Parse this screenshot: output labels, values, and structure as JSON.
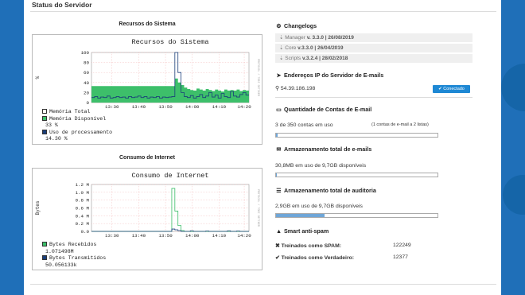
{
  "panel": {
    "title": "Status do Servidor"
  },
  "sys": {
    "section_title": "Recursos do Sistema",
    "chart_title": "Recursos do Sistema",
    "ylabel": "%",
    "side_label": "PROTOCOL / TOBI OETIKER",
    "legend": [
      {
        "label": "Memória Total",
        "value": "",
        "color": "#ffffff"
      },
      {
        "label": "Memória Disponível",
        "value": "33 %",
        "color": "#3dbf6a"
      },
      {
        "label": "Uso de processamento",
        "value": "14.30 %",
        "color": "#1a3f7a"
      }
    ]
  },
  "net": {
    "section_title": "Consumo de Internet",
    "chart_title": "Consumo de Internet",
    "ylabel": "Bytes",
    "side_label": "PROTOCOL / TOBI OETIKER",
    "legend": [
      {
        "label": "Bytes Recebidos",
        "value": "1.071498M",
        "color": "#3dbf6a"
      },
      {
        "label": "Bytes Transmitidos",
        "value": "50.056133k",
        "color": "#1a3f7a"
      }
    ]
  },
  "chart_data": [
    {
      "type": "area",
      "title": "Recursos do Sistema",
      "ylabel": "%",
      "ylim": [
        0,
        100
      ],
      "x_ticks": [
        "13:30",
        "13:40",
        "13:50",
        "14:00",
        "14:10",
        "14:20"
      ],
      "y_ticks": [
        "0",
        "20",
        "40",
        "60",
        "80",
        "100"
      ],
      "series": [
        {
          "name": "Memória Disponível",
          "values": [
            33,
            33,
            33,
            33,
            33,
            33,
            33,
            33,
            33,
            33,
            33,
            33,
            33,
            33,
            33,
            33,
            33,
            33,
            33,
            33,
            33,
            33,
            33,
            33,
            33,
            33,
            33,
            48,
            40,
            35,
            30,
            27,
            25,
            24,
            28,
            26,
            24,
            27,
            25,
            23,
            26,
            24,
            22,
            26,
            24,
            25,
            24,
            26,
            23,
            25,
            24
          ]
        },
        {
          "name": "Uso de processamento",
          "values": [
            10,
            12,
            9,
            11,
            10,
            13,
            9,
            10,
            12,
            10,
            11,
            9,
            12,
            10,
            11,
            13,
            10,
            12,
            9,
            11,
            10,
            12,
            9,
            11,
            10,
            11,
            12,
            100,
            60,
            20,
            12,
            10,
            14,
            9,
            12,
            16,
            10,
            13,
            20,
            11,
            15,
            9,
            18,
            12,
            10,
            22,
            13,
            11,
            16,
            20,
            15
          ]
        }
      ]
    },
    {
      "type": "line",
      "title": "Consumo de Internet",
      "ylabel": "Bytes",
      "ylim": [
        0,
        1200000
      ],
      "x_ticks": [
        "13:30",
        "13:40",
        "13:50",
        "14:00",
        "14:10",
        "14:20"
      ],
      "y_ticks": [
        "0.0",
        "0.2 M",
        "0.4 M",
        "0.6 M",
        "0.8 M",
        "1.0 M",
        "1.2 M"
      ],
      "series": [
        {
          "name": "Bytes Recebidos",
          "values": [
            0,
            0,
            0,
            0,
            0,
            0,
            0,
            0,
            0,
            0,
            0,
            0,
            0,
            0,
            0,
            0,
            0,
            0,
            0,
            0,
            0,
            0,
            0,
            0,
            0,
            0,
            1100000,
            520000,
            150000,
            20000,
            0,
            0,
            0,
            0,
            0,
            0,
            0,
            0,
            0,
            0,
            0,
            0,
            0,
            0,
            0,
            0,
            0,
            0,
            0,
            0,
            0
          ]
        },
        {
          "name": "Bytes Transmitidos",
          "values": [
            0,
            0,
            0,
            0,
            0,
            0,
            0,
            0,
            0,
            0,
            0,
            0,
            0,
            0,
            0,
            0,
            0,
            0,
            0,
            0,
            0,
            0,
            0,
            0,
            0,
            0,
            60000,
            40000,
            20000,
            0,
            0,
            0,
            15000,
            0,
            0,
            0,
            0,
            10000,
            0,
            0,
            0,
            0,
            0,
            0,
            15000,
            0,
            0,
            10000,
            0,
            0,
            0
          ]
        }
      ]
    }
  ],
  "changelogs": {
    "title": "Changelogs",
    "items": [
      {
        "name": "Manager",
        "version": "v. 3.3.0 | 26/08/2019"
      },
      {
        "name": "Core",
        "version": "v.3.3.0 | 26/04/2019"
      },
      {
        "name": "Scripts",
        "version": "v.3.2.4 | 28/02/2018"
      }
    ]
  },
  "ip": {
    "title": "Endereços IP do Servidor de E-mails",
    "address": "54.39.186.198",
    "status": "Conectado"
  },
  "accounts": {
    "title": "Quantidade de Contas de E-mail",
    "text": "3 de 350 contas em uso",
    "note": "(1 contas de e-mail a 2 listas)",
    "fraction": 0.0086
  },
  "storage": {
    "title": "Armazenamento total de e-mails",
    "text": "30,8MB em uso de 9,7GB disponíveis",
    "fraction": 0.003
  },
  "audit": {
    "title": "Armazenamento total de auditoria",
    "text": "2,9GB em uso de 9,7GB disponíveis",
    "fraction": 0.3
  },
  "spam": {
    "title": "Smart anti-spam",
    "spam_label": "Treinados como SPAM:",
    "spam_value": "122249",
    "ham_label": "Treinados como Verdadeiro:",
    "ham_value": "12377"
  }
}
